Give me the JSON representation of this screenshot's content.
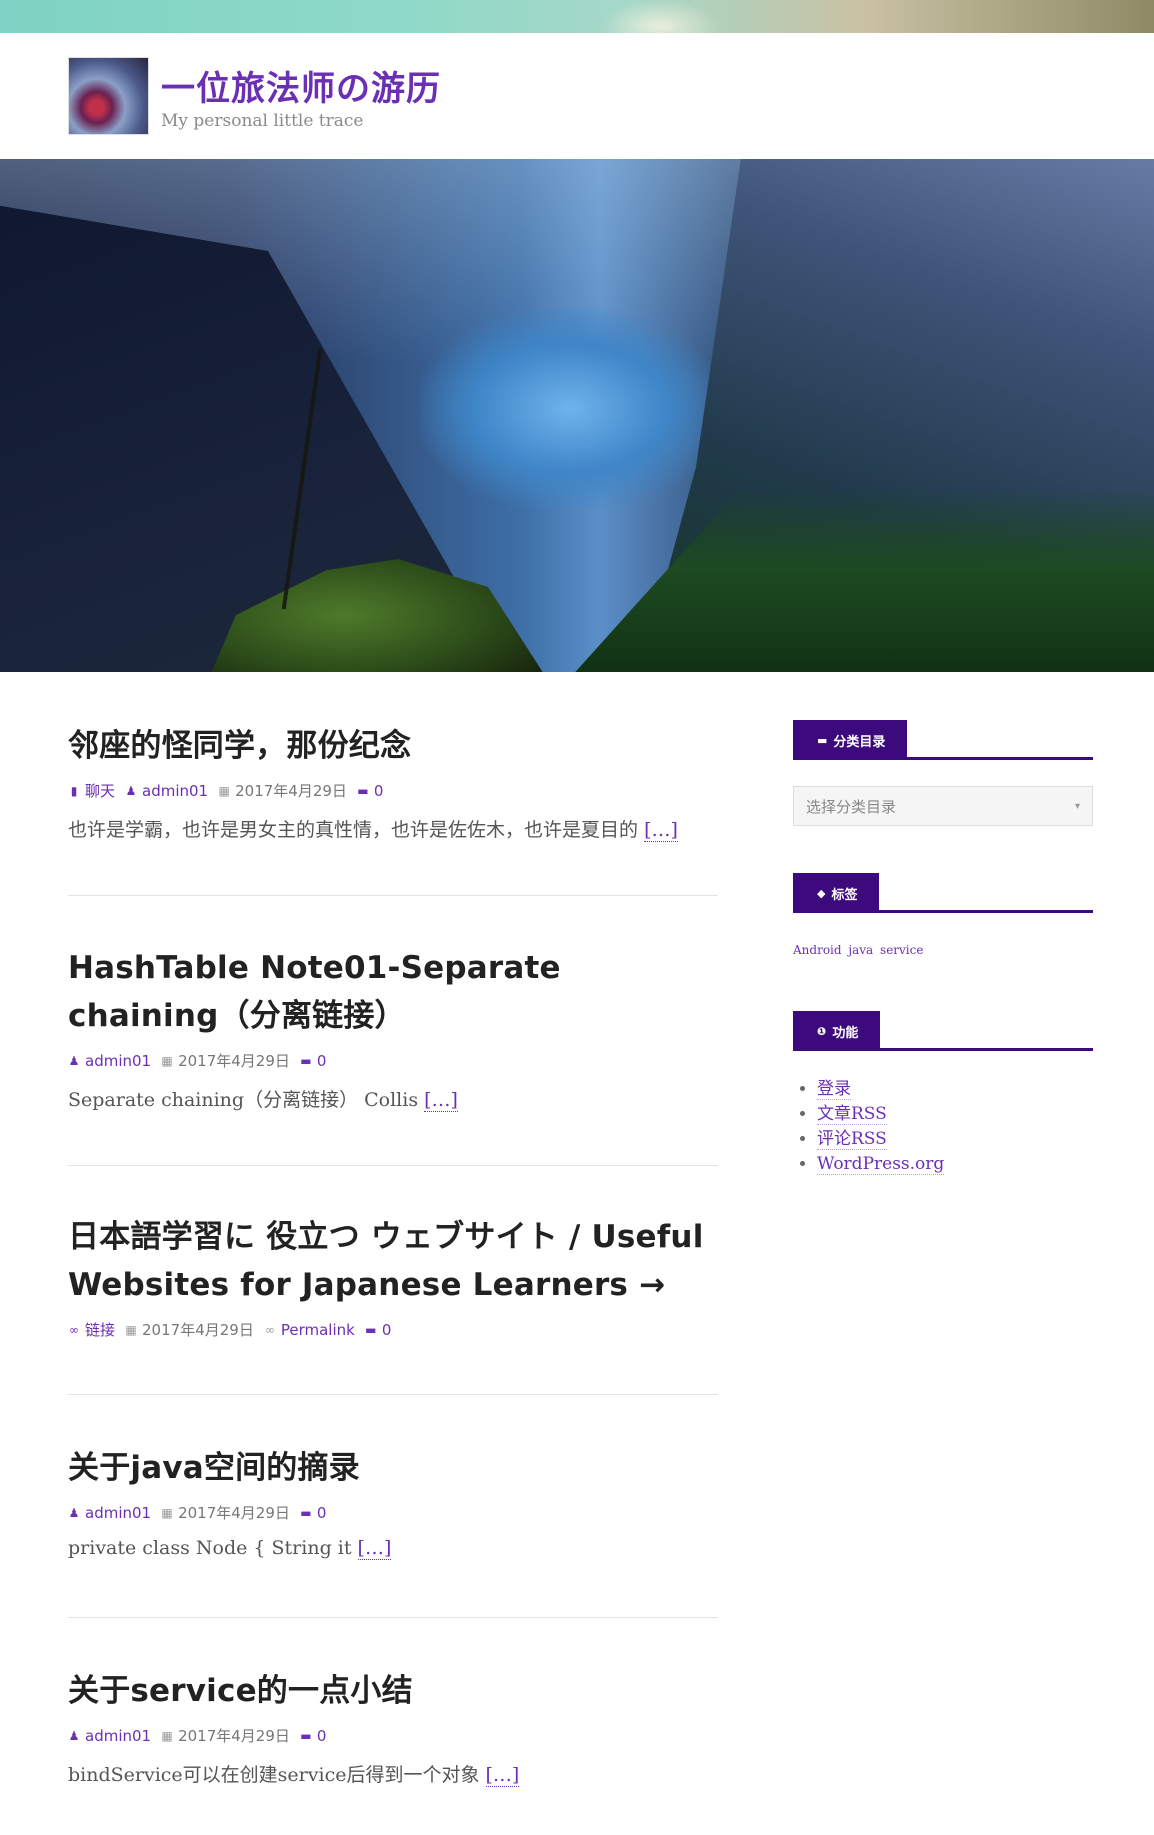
{
  "header": {
    "site_title": "一位旅法师の游历",
    "tagline": "My personal little trace"
  },
  "posts": [
    {
      "title_lines": [
        "邻座的怪同学，那份纪念"
      ],
      "format": "聊天",
      "author": "admin01",
      "date": "2017年4月29日",
      "comments": "0",
      "excerpt": "也许是学霸，也许是男女主的真性情，也许是佐佐木，也许是夏目的",
      "more": "[…]"
    },
    {
      "title_lines": [
        "HashTable Note01-Separate",
        "chaining（分离链接）"
      ],
      "author": "admin01",
      "date": "2017年4月29日",
      "comments": "0",
      "excerpt": "Separate chaining（分离链接） Collis",
      "more": "[…]"
    },
    {
      "title_lines": [
        "日本語学習に 役立つ ウェブサイト / Useful",
        "Websites for Japanese Learners →"
      ],
      "format": "链接",
      "date": "2017年4月29日",
      "permalink": "Permalink",
      "comments": "0"
    },
    {
      "title_lines": [
        "关于java空间的摘录"
      ],
      "author": "admin01",
      "date": "2017年4月29日",
      "comments": "0",
      "excerpt": "private class Node { String it",
      "more": "[…]"
    },
    {
      "title_lines": [
        "关于service的一点小结"
      ],
      "author": "admin01",
      "date": "2017年4月29日",
      "comments": "0",
      "excerpt": "bindService可以在创建service后得到一个对象",
      "more": "[…]"
    }
  ],
  "sidebar": {
    "categories": {
      "title": "分类目录",
      "icon": "folder-icon",
      "select_placeholder": "选择分类目录"
    },
    "tags": {
      "title": "标签",
      "icon": "tag-icon",
      "items": [
        "Android",
        "java",
        "service"
      ]
    },
    "meta": {
      "title": "功能",
      "icon": "info-icon",
      "items": [
        "登录",
        "文章RSS",
        "评论RSS",
        "WordPress.org"
      ]
    }
  },
  "colors": {
    "accent": "#6b2fb3",
    "widget_bg": "#3d0a7e"
  }
}
